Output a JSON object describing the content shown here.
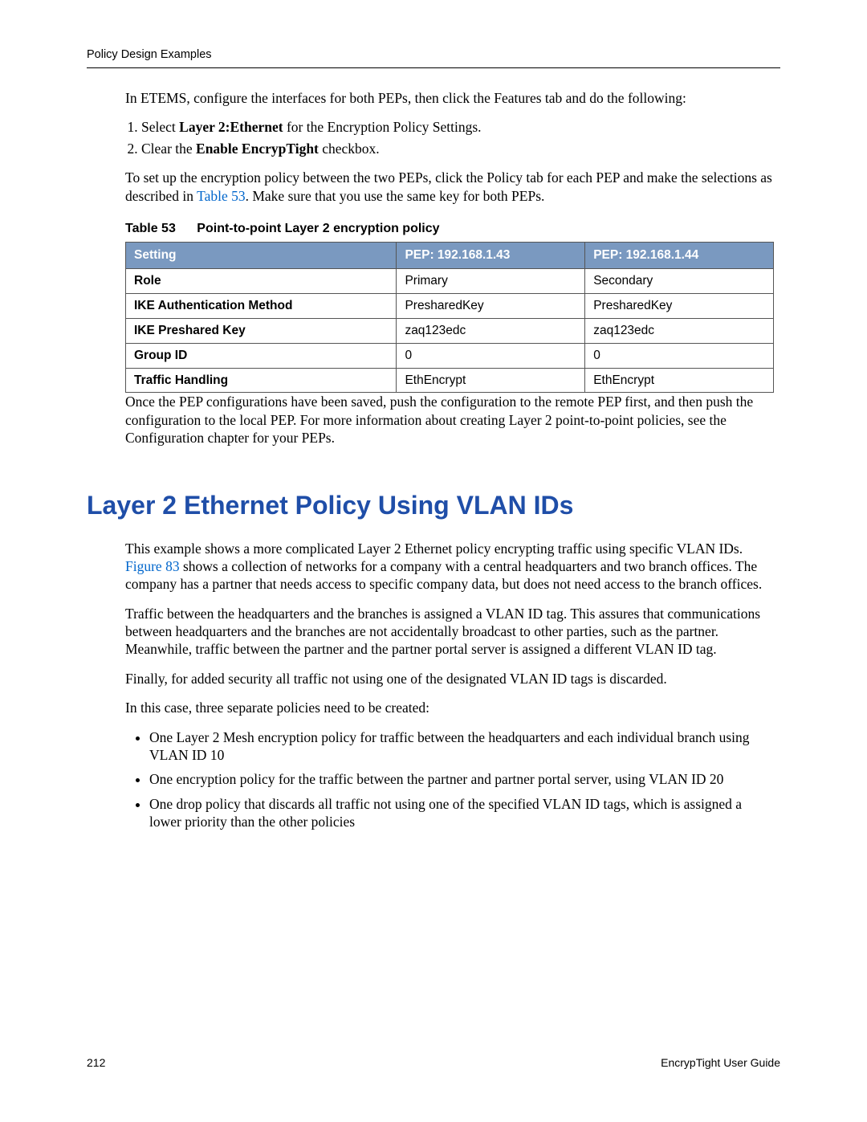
{
  "header": {
    "title": "Policy Design Examples"
  },
  "intro": "In ETEMS, configure the interfaces for both PEPs, then click the Features tab and do the following:",
  "steps": {
    "s1_pre": "Select ",
    "s1_bold": "Layer 2:Ethernet",
    "s1_post": " for the Encryption Policy Settings.",
    "s2_pre": "Clear the ",
    "s2_bold": "Enable EncrypTight",
    "s2_post": " checkbox."
  },
  "para2_pre": "To set up the encryption policy between the two PEPs, click the Policy tab for each PEP and make the selections as described in ",
  "para2_link": "Table 53",
  "para2_post": ". Make sure that you use the same key for both PEPs.",
  "table": {
    "num": "Table 53",
    "caption": "Point-to-point Layer 2 encryption policy",
    "headers": {
      "c1": "Setting",
      "c2": "PEP: 192.168.1.43",
      "c3": "PEP: 192.168.1.44"
    },
    "rows": [
      {
        "c1": "Role",
        "c2": "Primary",
        "c3": "Secondary"
      },
      {
        "c1": "IKE Authentication Method",
        "c2": "PresharedKey",
        "c3": "PresharedKey"
      },
      {
        "c1": "IKE Preshared Key",
        "c2": "zaq123edc",
        "c3": "zaq123edc"
      },
      {
        "c1": "Group ID",
        "c2": "0",
        "c3": "0"
      },
      {
        "c1": "Traffic Handling",
        "c2": "EthEncrypt",
        "c3": "EthEncrypt"
      }
    ]
  },
  "para3": "Once the PEP configurations have been saved, push the configuration to the remote PEP first, and then push the configuration to the local PEP. For more information about creating Layer 2 point-to-point policies, see the Configuration chapter for your PEPs.",
  "h2": "Layer 2 Ethernet Policy Using VLAN IDs",
  "sec2_p1_pre": "This example shows a more complicated Layer 2 Ethernet policy encrypting traffic using specific VLAN IDs. ",
  "sec2_p1_link": "Figure 83",
  "sec2_p1_post": " shows a collection of networks for a company with a central headquarters and two branch offices. The company has a partner that needs access to specific company data, but does not need access to the branch offices.",
  "sec2_p2": "Traffic between the headquarters and the branches is assigned a VLAN ID tag. This assures that communications between headquarters and the branches are not accidentally broadcast to other parties, such as the partner. Meanwhile, traffic between the partner and the partner portal server is assigned a different VLAN ID tag.",
  "sec2_p3": "Finally, for added security all traffic not using one of the designated VLAN ID tags is discarded.",
  "sec2_p4": "In this case, three separate policies need to be created:",
  "bullets": {
    "b1": "One Layer 2 Mesh encryption policy for traffic between the headquarters and each individual branch using VLAN ID 10",
    "b2": "One encryption policy for the traffic between the partner and partner portal server, using VLAN ID 20",
    "b3": "One drop policy that discards all traffic not using one of the specified VLAN ID tags, which is assigned a lower priority than the other policies"
  },
  "footer": {
    "page": "212",
    "guide": "EncrypTight User Guide"
  }
}
